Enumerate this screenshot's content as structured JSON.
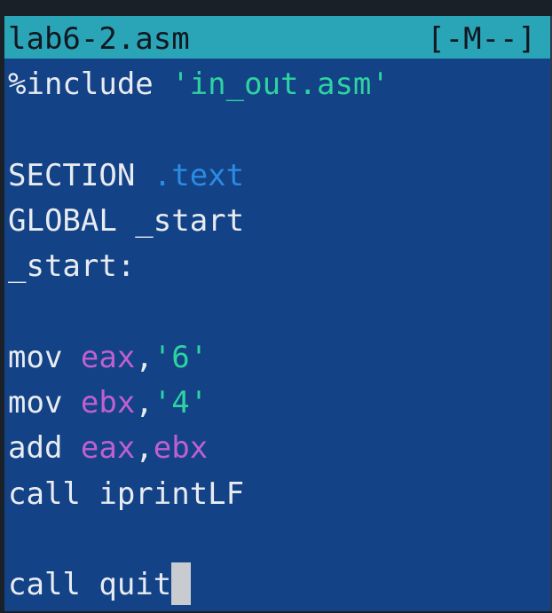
{
  "editor": {
    "filename": "lab6-2.asm",
    "status": "[-M--]"
  },
  "code": {
    "l1": {
      "a": "%include ",
      "b": "'in_out.asm'"
    },
    "l3": {
      "a": "SECTION ",
      "b": ".text"
    },
    "l4": {
      "a": "GLOBAL _start"
    },
    "l5": {
      "a": "_start:"
    },
    "l7": {
      "a": "mov ",
      "b": "eax",
      "c": ",",
      "d": "'6'"
    },
    "l8": {
      "a": "mov ",
      "b": "ebx",
      "c": ",",
      "d": "'4'"
    },
    "l9": {
      "a": "add ",
      "b": "eax",
      "c": ",",
      "d": "ebx"
    },
    "l10": {
      "a": "call iprintLF"
    },
    "l12": {
      "a": "call quit"
    }
  },
  "colors": {
    "background": "#134287",
    "title_bar": "#2aa5b8",
    "string": "#2ed3a0",
    "directive": "#2b8be0",
    "register": "#c060d0",
    "text": "#e8ecf0"
  }
}
